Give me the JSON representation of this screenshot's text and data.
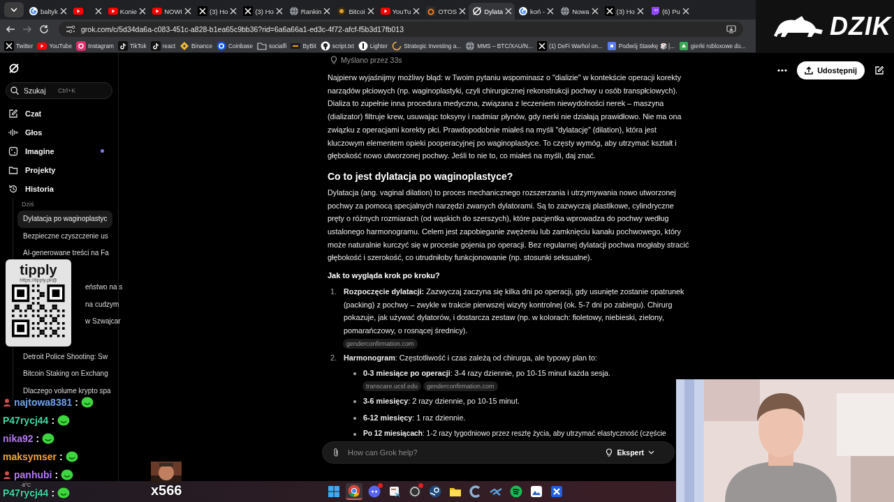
{
  "tabs": [
    {
      "label": "baltyk",
      "selected": false
    },
    {
      "selected": false
    },
    {
      "label": "Konie",
      "selected": false
    },
    {
      "label": "NOWI",
      "selected": false
    },
    {
      "label": "(3) Ho",
      "selected": false
    },
    {
      "label": "(3) Ho",
      "selected": false
    },
    {
      "label": "Rankin",
      "selected": false
    },
    {
      "label": "Bitcoi",
      "selected": false
    },
    {
      "label": "YouTu",
      "selected": false
    },
    {
      "label": "OTOS",
      "selected": false
    },
    {
      "label": "Dylata",
      "selected": true
    },
    {
      "label": "koń -",
      "selected": false
    },
    {
      "label": "Nowa",
      "selected": false
    },
    {
      "label": "(3) Ho",
      "selected": false
    },
    {
      "label": "(6) Pu",
      "selected": false
    }
  ],
  "address_bar": {
    "url": "grok.com/c/5d34da6a-c083-451c-a828-b1ea65c9bb36?rid=6a6a66a1-ed3c-4f72-afcf-f5b3d17fb013"
  },
  "bookmarks": [
    "Twitter",
    "YouTube",
    "Instagram",
    "TikTok",
    "react",
    "Binance",
    "Coinbase",
    "socialfi",
    "ByBit",
    "script.txt",
    "Lighter",
    "Strategic Investing a...",
    "MMS – BTC/XAU/N...",
    "(1) DeFi Warhol on...",
    "Podwój Stawkę 🎲 |...",
    "gierki robloxowe do..."
  ],
  "sidebar": {
    "search": {
      "placeholder": "Szukaj",
      "shortcut": "Ctrl+K"
    },
    "nav": [
      {
        "label": "Czat",
        "badge": false
      },
      {
        "label": "Głos",
        "badge": false
      },
      {
        "label": "Imagine",
        "badge": true
      },
      {
        "label": "Projekty",
        "badge": false
      },
      {
        "label": "Historia",
        "badge": false
      }
    ],
    "history_groups": [
      {
        "label": "Dziś",
        "items": [
          {
            "kind": "full",
            "label": "Dylatacja po waginoplastyc",
            "selected": true
          },
          {
            "kind": "full",
            "label": "Bezpieczne czyszczenie us",
            "selected": false
          },
          {
            "kind": "full",
            "label": "AI-generowane treści na Fa",
            "selected": false
          },
          {
            "kind": "partial",
            "label": "eństwo na s",
            "selected": false
          },
          {
            "kind": "partial",
            "label": "na cudzym",
            "selected": false
          },
          {
            "kind": "partial",
            "label": "w Szwajcar",
            "selected": false
          }
        ]
      },
      {
        "items": [
          {
            "kind": "full",
            "label": "Detroit Police Shooting: Sw",
            "selected": false
          },
          {
            "kind": "full",
            "label": "Bitcoin Staking on Exchang",
            "selected": false
          },
          {
            "kind": "full",
            "label": "Dlaczego volume krypto spa",
            "selected": false
          }
        ]
      }
    ]
  },
  "header": {
    "share_label": "Udostępnij"
  },
  "response": {
    "thought": "Myślano przez 33s",
    "blocks": [
      {
        "kind": "p",
        "text": "Najpierw wyjaśnijmy możliwy błąd: w Twoim pytaniu wspominasz o \"dializie\" w kontekście operacji korekty narządów płciowych (np. waginoplastyki, czyli chirurgicznej rekonstrukcji pochwy u osób transpłciowych). Dializa to zupełnie inna procedura medyczna, związana z leczeniem niewydolności nerek – maszyna (dializator) filtruje krew, usuwając toksyny i nadmiar płynów, gdy nerki nie działają prawidłowo. Nie ma ona związku z operacjami korekty płci. Prawdopodobnie miałeś na myśli \"dylatację\" (dilation), która jest kluczowym elementem opieki pooperacyjnej po waginoplastyce. To częsty wymóg, aby utrzymać kształt i głębokość nowo utworzonej pochwy. Jeśli to nie to, co miałeś na myśli, daj znać."
      },
      {
        "kind": "h2",
        "text": "Co to jest dylatacja po waginoplastyce?"
      },
      {
        "kind": "p",
        "text": "Dylatacja (ang. vaginal dilation) to proces mechanicznego rozszerzania i utrzymywania nowo utworzonej pochwy za pomocą specjalnych narzędzi zwanych dylatorami. Są to zazwyczaj plastikowe, cylindryczne pręty o różnych rozmiarach (od wąskich do szerszych), które pacjentka wprowadza do pochwy według ustalonego harmonogramu. Celem jest zapobieganie zwężeniu lub zamknięciu kanału pochwowego, który może naturalnie kurczyć się w procesie gojenia po operacji. Bez regularnej dylatacji pochwa mogłaby stracić głębokość i szerokość, co utrudniłoby funkcjonowanie (np. stosunki seksualne)."
      },
      {
        "kind": "h3",
        "text": "Jak to wygląda krok po kroku?"
      },
      {
        "kind": "ol",
        "number": "1.",
        "text": "**Rozpoczęcie dylatacji:** Zazwyczaj zaczyna się kilka dni po operacji, gdy usunięte zostanie opatrunek (packing) z pochwy – zwykle w trakcie pierwszej wizyty kontrolnej (ok. 5-7 dni po zabiegu). Chirurg pokazuje, jak używać dylatorów, i dostarcza zestaw (np. w kolorach: fioletowy, niebieski, zielony, pomarańczowy, o rosnącej średnicy).",
        "sources": [
          "genderconfirmation.com"
        ]
      },
      {
        "kind": "ol",
        "number": "2.",
        "text": "**Harmonogram**: Częstotliwość i czas zależą od chirurga, ale typowy plan to:"
      },
      {
        "kind": "li",
        "text": "**0-3 miesiące po operacji**: 3-4 razy dziennie, po 10-15 minut każda sesja.",
        "sources": [
          "transcare.ucsf.edu",
          "genderconfirmation.com"
        ]
      },
      {
        "kind": "li",
        "text": "**3-6 miesięcy**: 2 razy dziennie, po 10-15 minut."
      },
      {
        "kind": "li",
        "text": "**6-12 miesięcy**: 1 raz dziennie."
      },
      {
        "kind": "li_cut",
        "text": "**Po 12 miesiącach**: 1-2 razy tygodniowo przez resztę życia, aby utrzymać elastyczność (częście"
      }
    ]
  },
  "composer": {
    "placeholder": "How can Grok help?",
    "mode": "Ekspert"
  },
  "taskbar": {
    "weather": "-6°C",
    "apps": [
      {
        "active": false,
        "badge": false
      },
      {
        "active": true,
        "badge": false
      },
      {
        "active": false,
        "badge": true
      },
      {
        "active": false,
        "badge": false
      },
      {
        "active": false,
        "badge": true
      },
      {
        "active": false,
        "badge": false
      },
      {
        "active": false,
        "badge": false
      },
      {
        "active": false,
        "badge": false
      },
      {
        "active": false,
        "badge": false
      },
      {
        "active": false,
        "badge": false
      },
      {
        "active": false,
        "badge": false
      },
      {
        "active": false,
        "badge": false
      }
    ]
  },
  "overlays": {
    "logo_text": "DZIK",
    "tip_title": "tipply",
    "tip_url": "https://tipply.pl/@",
    "chat": [
      {
        "user": "najtowa8381",
        "color": "#6fa0e8",
        "badge": true
      },
      {
        "user": "P47rycj44",
        "color": "#3ed6a0",
        "badge": false
      },
      {
        "user": "nika92",
        "color": "#b477f5",
        "badge": false
      },
      {
        "user": "maksymser",
        "color": "#f0a53a",
        "badge": false
      },
      {
        "user": "panhubi",
        "color": "#b477f5",
        "badge": true
      },
      {
        "user": "P47rycj44",
        "color": "#3ed6a0",
        "badge": false
      }
    ],
    "separator": ":",
    "combo": "x566"
  }
}
